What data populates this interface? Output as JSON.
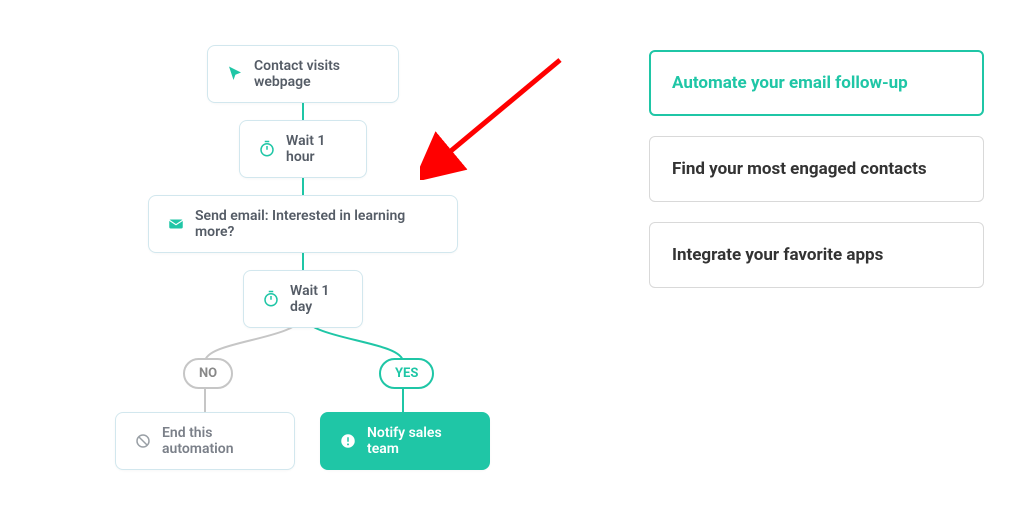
{
  "colors": {
    "accent": "#1fc6a6",
    "arrow": "#ff0000",
    "node_border": "#d2e7ee",
    "muted": "#888888"
  },
  "workflow": {
    "start": {
      "label": "Contact visits webpage",
      "icon": "cursor-icon"
    },
    "wait1": {
      "label": "Wait 1 hour",
      "icon": "stopwatch-icon"
    },
    "email": {
      "label": "Send email: Interested in learning more?",
      "icon": "envelope-icon"
    },
    "wait2": {
      "label": "Wait 1 day",
      "icon": "stopwatch-icon"
    },
    "branch": {
      "no_label": "NO",
      "yes_label": "YES"
    },
    "no_end": {
      "label": "End this automation",
      "icon": "prohibit-icon"
    },
    "yes_end": {
      "label": "Notify sales team",
      "icon": "alert-icon"
    }
  },
  "options": [
    {
      "label": "Automate your email follow-up",
      "active": true
    },
    {
      "label": "Find your most engaged contacts",
      "active": false
    },
    {
      "label": "Integrate your favorite apps",
      "active": false
    }
  ]
}
